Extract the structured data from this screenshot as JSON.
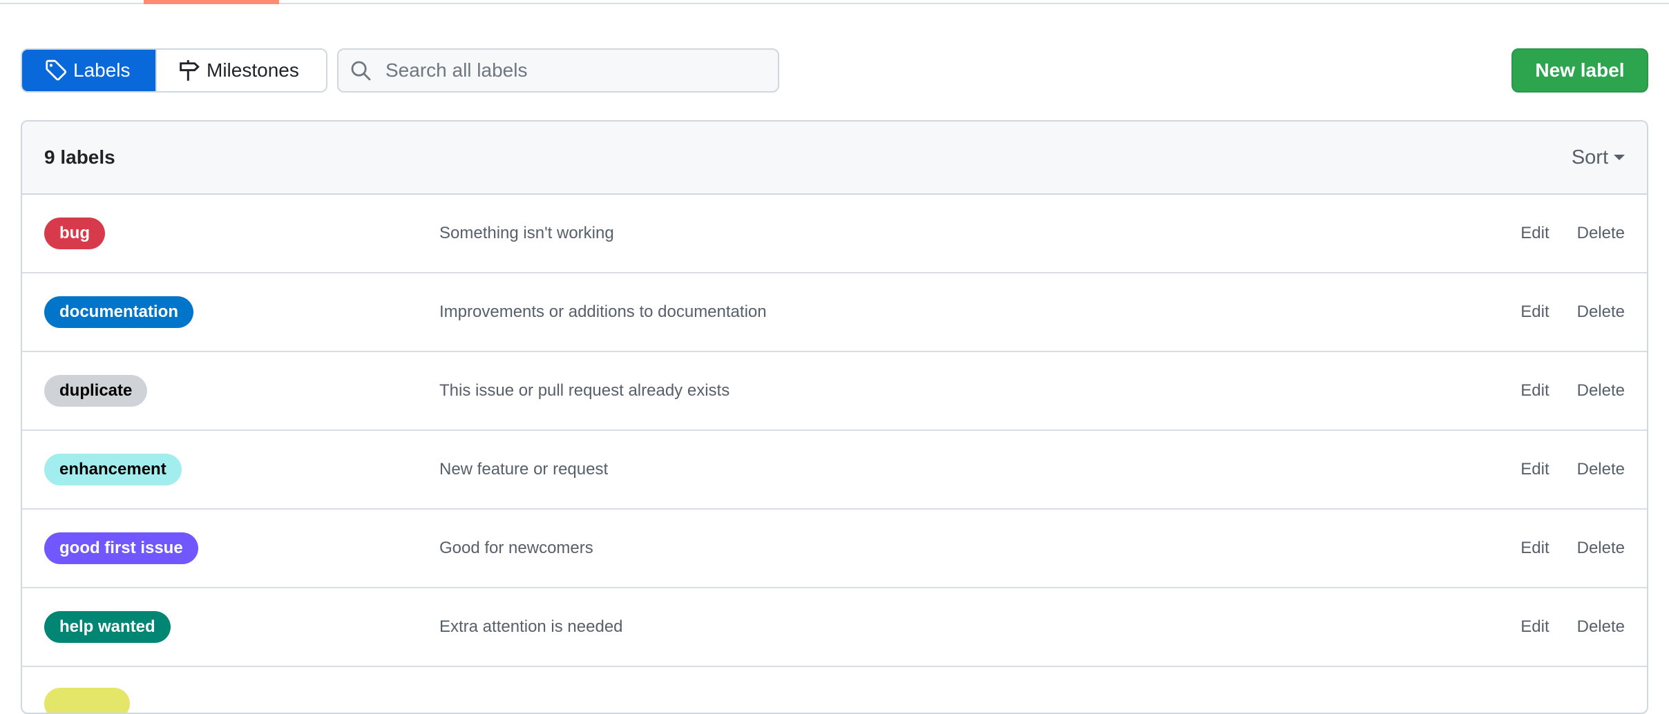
{
  "toolbar": {
    "labels_label": "Labels",
    "milestones_label": "Milestones",
    "search_placeholder": "Search all labels",
    "new_label": "New label"
  },
  "list": {
    "count_text": "9 labels",
    "sort_label": "Sort",
    "edit_label": "Edit",
    "delete_label": "Delete",
    "labels": [
      {
        "name": "bug",
        "description": "Something isn't working",
        "bg": "#d73a4a",
        "fg": "#ffffff"
      },
      {
        "name": "documentation",
        "description": "Improvements or additions to documentation",
        "bg": "#0075ca",
        "fg": "#ffffff"
      },
      {
        "name": "duplicate",
        "description": "This issue or pull request already exists",
        "bg": "#cfd3d7",
        "fg": "#000000"
      },
      {
        "name": "enhancement",
        "description": "New feature or request",
        "bg": "#a2eeef",
        "fg": "#000000"
      },
      {
        "name": "good first issue",
        "description": "Good for newcomers",
        "bg": "#7057ff",
        "fg": "#ffffff"
      },
      {
        "name": "help wanted",
        "description": "Extra attention is needed",
        "bg": "#008672",
        "fg": "#ffffff"
      },
      {
        "name": "",
        "description": "",
        "bg": "#e4e669",
        "fg": "#000000"
      }
    ]
  },
  "icons": {
    "labels": "tag-icon",
    "milestones": "milestone-icon",
    "search": "search-icon",
    "sort": "caret-down-icon"
  },
  "colors": {
    "accent": "#0969da",
    "primary_button": "#2da44e",
    "tab_underline": "#fd8c73"
  }
}
